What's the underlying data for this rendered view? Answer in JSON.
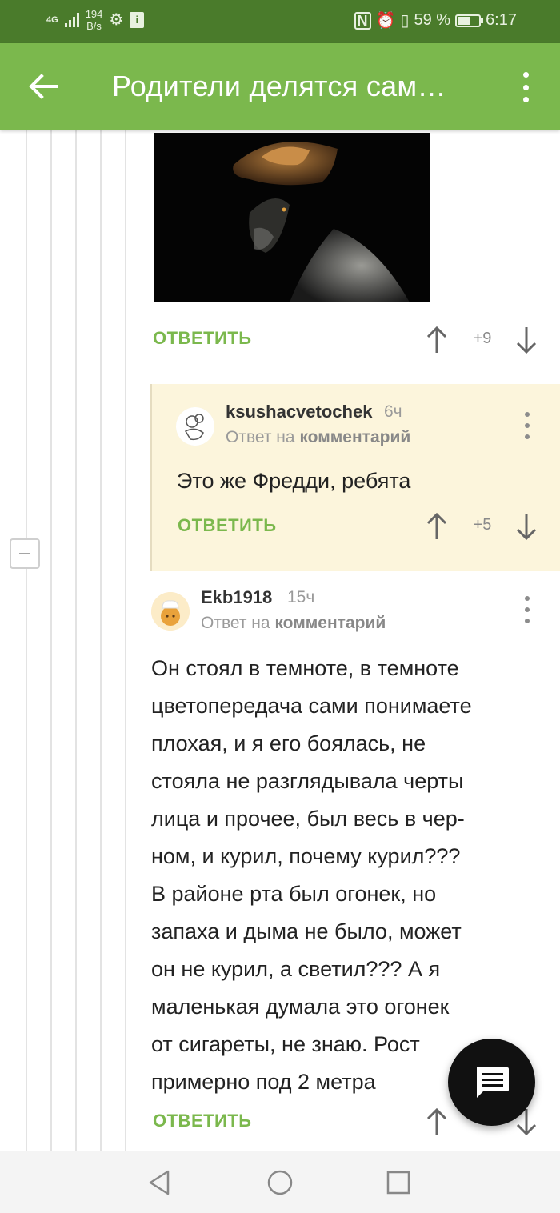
{
  "status_bar": {
    "network": "4G",
    "speed_value": "194",
    "speed_unit": "B/s",
    "battery_percent": "59 %",
    "battery_level": 0.59,
    "time": "6:17"
  },
  "app_bar": {
    "title": "Родители делятся сам…",
    "back_icon": "arrow-left-icon",
    "menu_icon": "more-vert-icon"
  },
  "parent_comment": {
    "image_description": "photo",
    "reply_label": "ОТВЕТИТЬ",
    "score": "+9"
  },
  "comments": [
    {
      "username": "ksushacvetochek",
      "time": "6ч",
      "reply_prefix": "Ответ на",
      "reply_target": "комментарий",
      "text": "Это же Фредди, ребята",
      "reply_label": "ОТВЕТИТЬ",
      "score": "+5"
    },
    {
      "username": "Ekb1918",
      "time": "15ч",
      "reply_prefix": "Ответ на",
      "reply_target": "комментарий",
      "lines": [
        "Он стоял в темноте, в темноте",
        "цветопередача сами понимаете",
        "плохая, и я его боялась, не",
        "стояла не разглядывала черты",
        "лица и прочее, был весь в чер-",
        "ном, и курил, почему курил???",
        "В районе рта был огонек, но",
        "запаха и дыма не было, может",
        "он не курил, а светил??? А я",
        "маленькая думала это огонек",
        "от сигареты, не знаю. Рост",
        "примерно под 2 метра"
      ],
      "reply_label": "ОТВЕТИТЬ"
    }
  ],
  "colors": {
    "status_bar": "#4a7b2b",
    "app_bar": "#7bb84d",
    "accent": "#7bb84d",
    "highlight_bg": "#fcf5dc"
  },
  "fab": {
    "icon": "comment-icon"
  },
  "nav": {
    "back": "nav-back-icon",
    "home": "nav-home-icon",
    "recents": "nav-recents-icon"
  }
}
